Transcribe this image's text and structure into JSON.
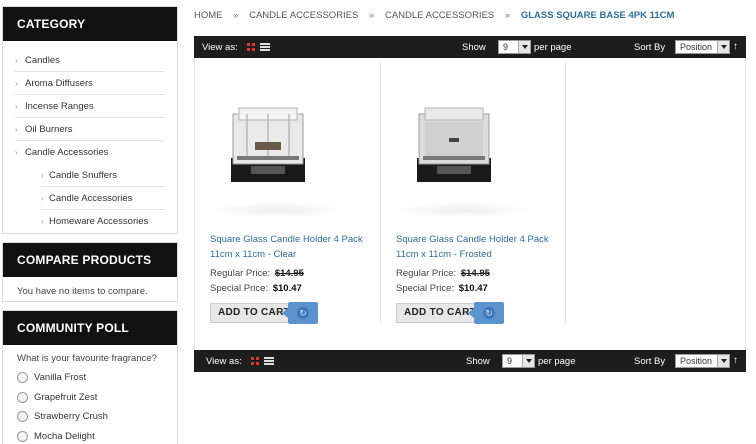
{
  "sidebar": {
    "category": {
      "title": "CATEGORY",
      "items": [
        "Candles",
        "Aroma Diffusers",
        "Incense Ranges",
        "Oil Burners",
        "Candle Accessories"
      ],
      "subitems": [
        "Candle Snuffers",
        "Candle Accessories",
        "Homeware Accessories"
      ]
    },
    "compare": {
      "title": "COMPARE PRODUCTS",
      "text": "You have no items to compare."
    },
    "poll": {
      "title": "COMMUNITY POLL",
      "question": "What is your favourite fragrance?",
      "options": [
        "Vanilla Frost",
        "Grapefruit Zest",
        "Strawberry Crush",
        "Mocha Delight"
      ]
    }
  },
  "breadcrumb": {
    "items": [
      "HOME",
      "CANDLE ACCESSORIES",
      "CANDLE ACCESSORIES"
    ],
    "separator": "»",
    "current": "GLASS SQUARE BASE 4PK 11CM"
  },
  "toolbar": {
    "view_as": "View as:",
    "show_label": "Show",
    "show_value": "9",
    "per_page": "per page",
    "sort_label": "Sort By",
    "sort_value": "Position",
    "sort_arrow": "↑"
  },
  "products": [
    {
      "name": "Square Glass Candle Holder 4 Pack 11cm x 11cm - Clear",
      "regular_label": "Regular Price:",
      "regular_price": "$14.95",
      "special_label": "Special Price:",
      "special_price": "$10.47",
      "button": "ADD TO CART"
    },
    {
      "name": "Square Glass Candle Holder 4 Pack 11cm x 11cm - Frosted",
      "regular_label": "Regular Price:",
      "regular_price": "$14.95",
      "special_label": "Special Price:",
      "special_price": "$10.47",
      "button": "ADD TO CART"
    }
  ],
  "colors": {
    "link": "#2c6e9a",
    "toolbar_bg": "#1d1d1d",
    "block_header_bg": "#111111",
    "cart_accent": "#5b93cf"
  }
}
